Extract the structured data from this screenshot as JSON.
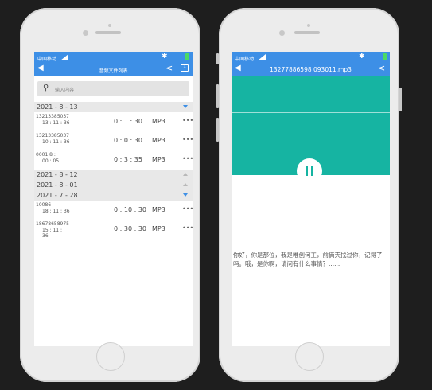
{
  "left_phone": {
    "status": {
      "carrier": "中国移动"
    },
    "header": {
      "title": "音频文件列表"
    },
    "search": {
      "placeholder": "输入内容"
    },
    "groups": [
      {
        "date": "2021 - 8 - 13",
        "expanded": true,
        "records": [
          {
            "name": "13213385037",
            "time": "13 : 11 : 36",
            "duration": "0 : 1 : 30",
            "format": "MP3"
          },
          {
            "name": "13213385037",
            "time": "10 : 11 : 36",
            "duration": "0 : 0 : 30",
            "format": "MP3"
          },
          {
            "name": "0001          8 :",
            "time": "00 : 05",
            "duration": "0 : 3 : 35",
            "format": "MP3"
          }
        ]
      },
      {
        "date": "2021 - 8 - 12",
        "expanded": false,
        "records": []
      },
      {
        "date": "2021 - 8 - 01",
        "expanded": false,
        "records": []
      },
      {
        "date": "2021 - 7 - 28",
        "expanded": true,
        "records": [
          {
            "name": "10086",
            "time": "18 : 11 : 36",
            "duration": "0 : 10 : 30",
            "format": "MP3"
          },
          {
            "name": "18678658975",
            "time": "15 : 11 :\n36",
            "duration": "0 : 30 : 30",
            "format": "MP3"
          }
        ]
      }
    ],
    "more_label": "•••"
  },
  "right_phone": {
    "status": {
      "carrier": "中国移动"
    },
    "header": {
      "title": "13277886598 093011.mp3"
    },
    "transcript": "你好，你是那位，我是唯创何工，前俩天找过你，记得了吗。哦，是你啊，请问有什么事情？......"
  },
  "icons": {
    "back": "back-arrow-icon",
    "bluetooth": "bluetooth-icon",
    "battery": "battery-icon",
    "share": "share-icon",
    "screen": "screen-icon",
    "search": "search-icon",
    "pause": "pause-icon"
  },
  "colors": {
    "header_blue": "#3d8fe6",
    "player_teal": "#16b4a2",
    "battery_green": "#4cd964"
  }
}
